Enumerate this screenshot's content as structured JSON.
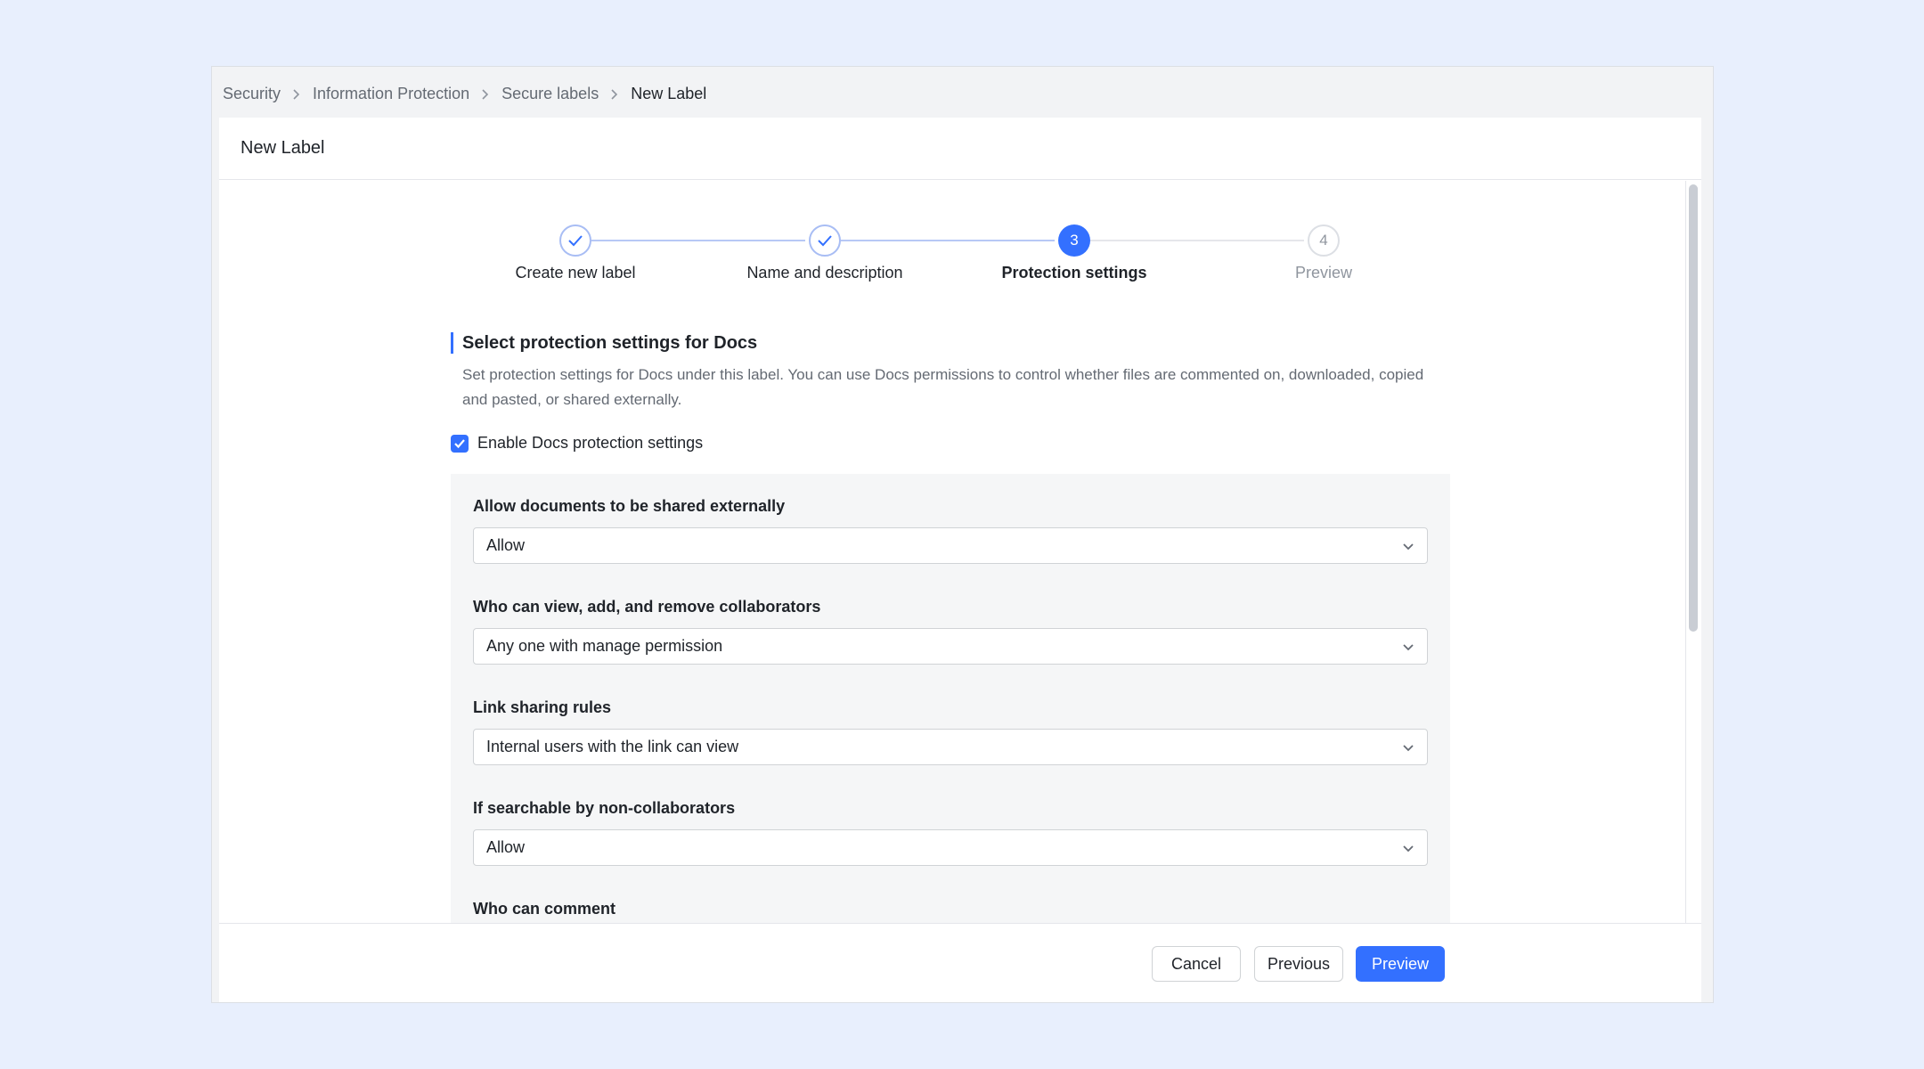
{
  "breadcrumb": {
    "items": [
      "Security",
      "Information Protection",
      "Secure labels",
      "New Label"
    ]
  },
  "page_title": "New Label",
  "stepper": {
    "steps": [
      {
        "number": "1",
        "label": "Create new label",
        "state": "done"
      },
      {
        "number": "2",
        "label": "Name and description",
        "state": "done"
      },
      {
        "number": "3",
        "label": "Protection settings",
        "state": "active"
      },
      {
        "number": "4",
        "label": "Preview",
        "state": "pending"
      }
    ]
  },
  "section": {
    "title": "Select protection settings for Docs",
    "description": "Set protection settings for Docs under this label. You can use Docs permissions to control whether files are commented on, downloaded, copied and pasted, or shared externally."
  },
  "enable_checkbox": {
    "label": "Enable Docs protection settings",
    "checked": true
  },
  "fields": [
    {
      "label": "Allow documents to be shared externally",
      "value": "Allow"
    },
    {
      "label": "Who can view, add, and remove collaborators",
      "value": "Any one with manage permission"
    },
    {
      "label": "Link sharing rules",
      "value": "Internal users with the link can view"
    },
    {
      "label": "If searchable by non-collaborators",
      "value": "Allow"
    },
    {
      "label": "Who can comment",
      "value": ""
    }
  ],
  "footer": {
    "cancel": "Cancel",
    "previous": "Previous",
    "preview": "Preview"
  },
  "colors": {
    "accent": "#3370ff",
    "background": "#e8effd"
  }
}
